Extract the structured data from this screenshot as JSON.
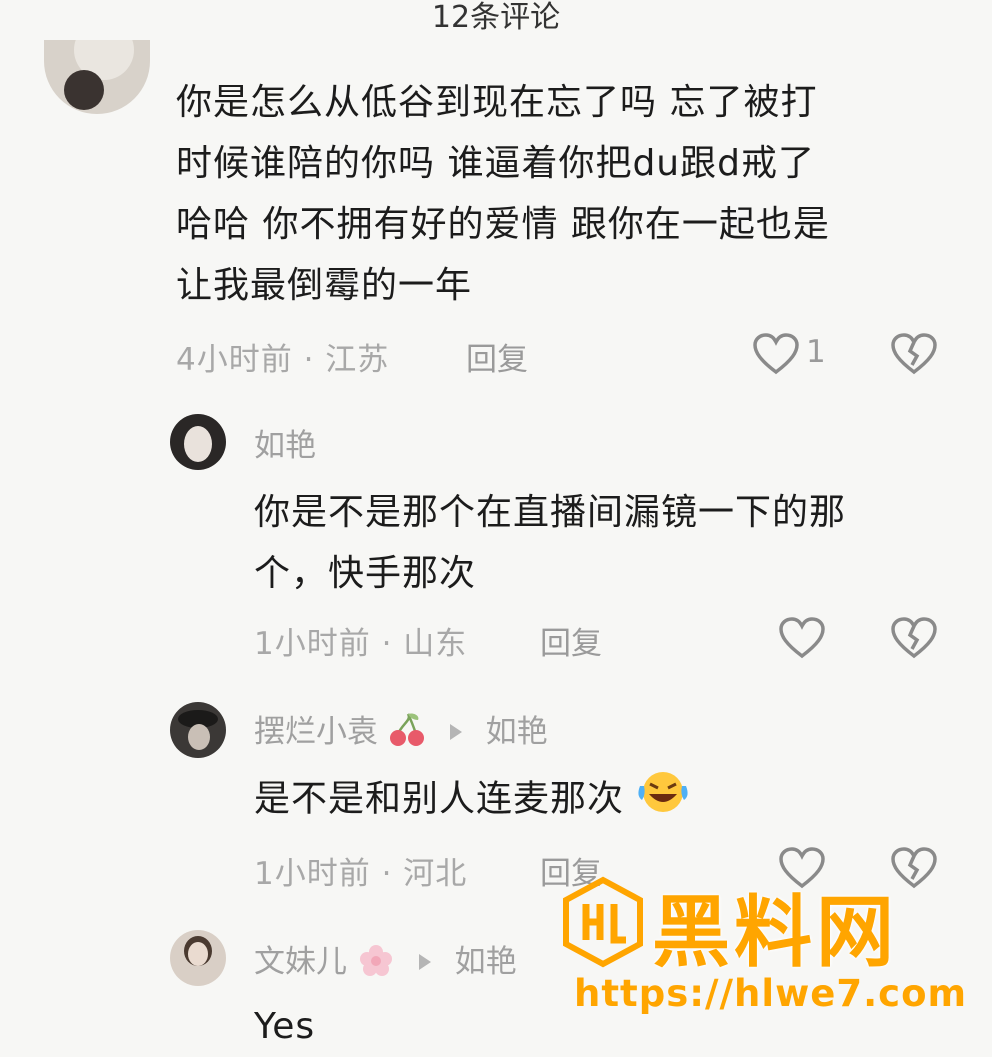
{
  "header": {
    "title": "12条评论"
  },
  "comments": [
    {
      "text_lines": [
        "你是怎么从低谷到现在忘了吗  忘了被打",
        "时候谁陪的你吗  谁逼着你把du跟d戒了",
        "哈哈 你不拥有好的爱情  跟你在一起也是",
        "让我最倒霉的一年"
      ],
      "meta": "4小时前 · 江苏",
      "reply_label": "回复",
      "likes": "1"
    },
    {
      "username": "如艳",
      "text_lines": [
        "你是不是那个在直播间漏镜一下的那",
        "个，快手那次"
      ],
      "meta": "1小时前 · 山东",
      "reply_label": "回复"
    },
    {
      "username": "摆烂小袁",
      "reply_to": "如艳",
      "text": "是不是和别人连麦那次",
      "meta": "1小时前 · 河北",
      "reply_label": "回复"
    },
    {
      "username": "文妹儿",
      "reply_to": "如艳",
      "text": "Yes"
    }
  ],
  "watermark": {
    "title": "黑料网",
    "url": "https://hlwe7.com",
    "logo_text": "HL"
  },
  "colors": {
    "watermark": "#ffa500",
    "meta": "#a8a8a8",
    "background": "#f7f7f5"
  }
}
